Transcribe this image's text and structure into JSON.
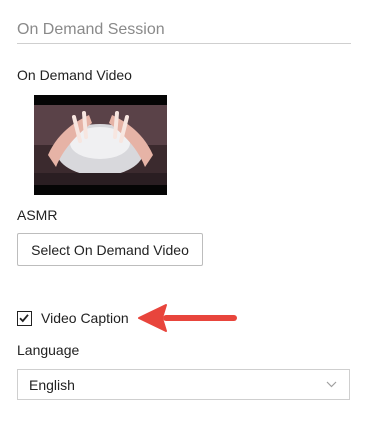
{
  "session": {
    "title": "On Demand Session"
  },
  "video": {
    "section_label": "On Demand Video",
    "name": "ASMR",
    "select_button_label": "Select On Demand Video"
  },
  "caption": {
    "label": "Video Caption",
    "checked": true
  },
  "language": {
    "label": "Language",
    "selected": "English",
    "icon": "chevron-down-icon"
  },
  "colors": {
    "arrow": "#e8453c",
    "divider": "#cfcfcf",
    "muted_text": "#8a8a8a"
  }
}
